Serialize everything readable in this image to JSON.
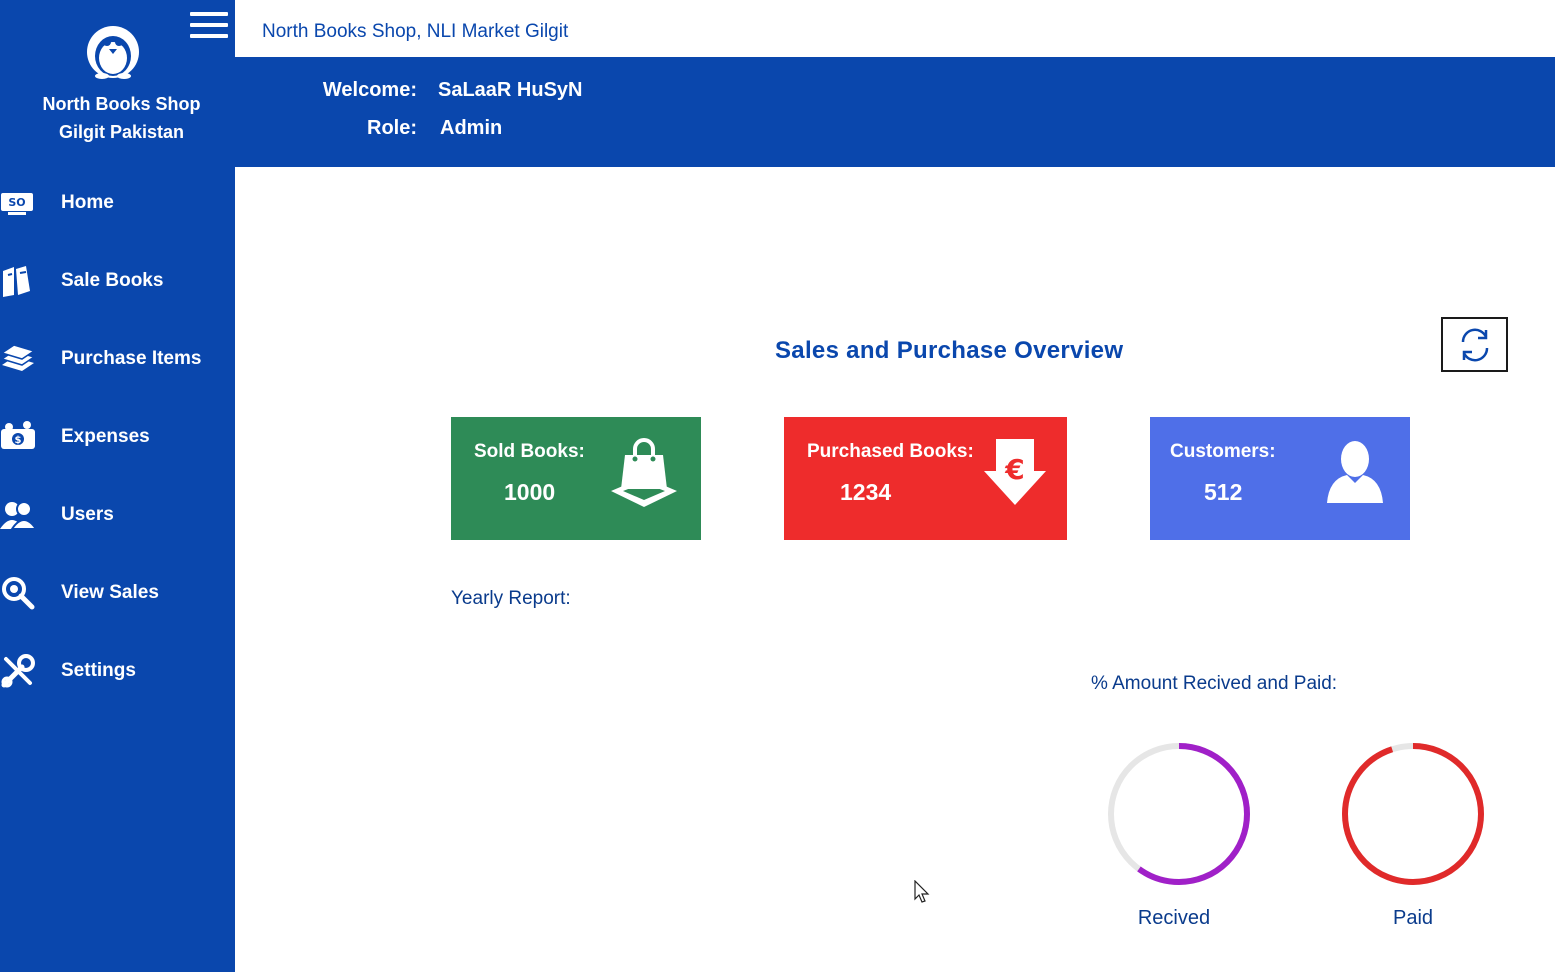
{
  "sidebar": {
    "brand_line1": "North Books Shop",
    "brand_line2": "Gilgit Pakistan",
    "items": [
      {
        "label": "Home",
        "icon": "home-icon"
      },
      {
        "label": "Sale Books",
        "icon": "sale-books-icon"
      },
      {
        "label": "Purchase Items",
        "icon": "purchase-items-icon"
      },
      {
        "label": "Expenses",
        "icon": "expenses-icon"
      },
      {
        "label": "Users",
        "icon": "users-icon"
      },
      {
        "label": "View Sales",
        "icon": "view-sales-icon"
      },
      {
        "label": "Settings",
        "icon": "settings-icon"
      }
    ]
  },
  "header": {
    "shop_title": "North Books Shop, NLI Market Gilgit",
    "welcome_label": "Welcome:",
    "welcome_value": "SaLaaR HuSyN",
    "role_label": "Role:",
    "role_value": "Admin"
  },
  "main": {
    "title": "Sales and Purchase Overview",
    "cards": {
      "sold": {
        "label": "Sold Books:",
        "value": "1000",
        "icon": "shopping-bag-icon",
        "color": "#2e8b57"
      },
      "purchased": {
        "label": "Purchased Books:",
        "value": "1234",
        "icon": "euro-down-arrow-icon",
        "color": "#ee2c2c"
      },
      "customers": {
        "label": "Customers:",
        "value": "512",
        "icon": "user-icon",
        "color": "#4f6fe8"
      }
    },
    "yearly_report_label": "Yearly Report:",
    "amount_title": "% Amount Recived and Paid:",
    "gauges": [
      {
        "label": "Recived",
        "fraction": 0.6,
        "color": "#a020c8"
      },
      {
        "label": "Paid",
        "fraction": 0.95,
        "color": "#e02a2a"
      }
    ]
  },
  "colors": {
    "primary": "#0a47ad",
    "text_dark_blue": "#0a3b8c"
  }
}
